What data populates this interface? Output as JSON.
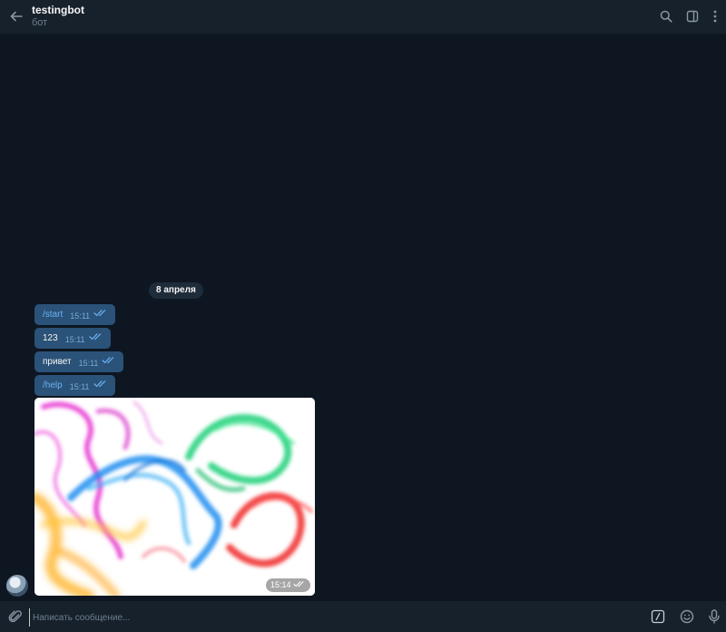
{
  "header": {
    "title": "testingbot",
    "subtitle": "бот",
    "icons": [
      "back-arrow-icon",
      "search-icon",
      "sidebar-toggle-icon",
      "more-vertical-icon"
    ]
  },
  "chat": {
    "date_label": "8 апреля",
    "messages": [
      {
        "text": "/start",
        "time": "15:11",
        "is_command": true,
        "status": "read"
      },
      {
        "text": "123",
        "time": "15:11",
        "is_command": false,
        "status": "read"
      },
      {
        "text": "привет",
        "time": "15:11",
        "is_command": false,
        "status": "read"
      },
      {
        "text": "/help",
        "time": "15:11",
        "is_command": true,
        "status": "read"
      }
    ],
    "photo_message": {
      "time": "15:14",
      "status": "read",
      "content": "colorful smoke image"
    }
  },
  "composer": {
    "placeholder": "Написать сообщение...",
    "icons": [
      "paperclip-icon",
      "bot-commands-icon",
      "emoji-icon",
      "microphone-icon"
    ]
  },
  "colors": {
    "background": "#0e1621",
    "header": "#17212b",
    "bubble": "#2b5278",
    "accent": "#6ab3f3",
    "muted": "#6d7f8f"
  }
}
